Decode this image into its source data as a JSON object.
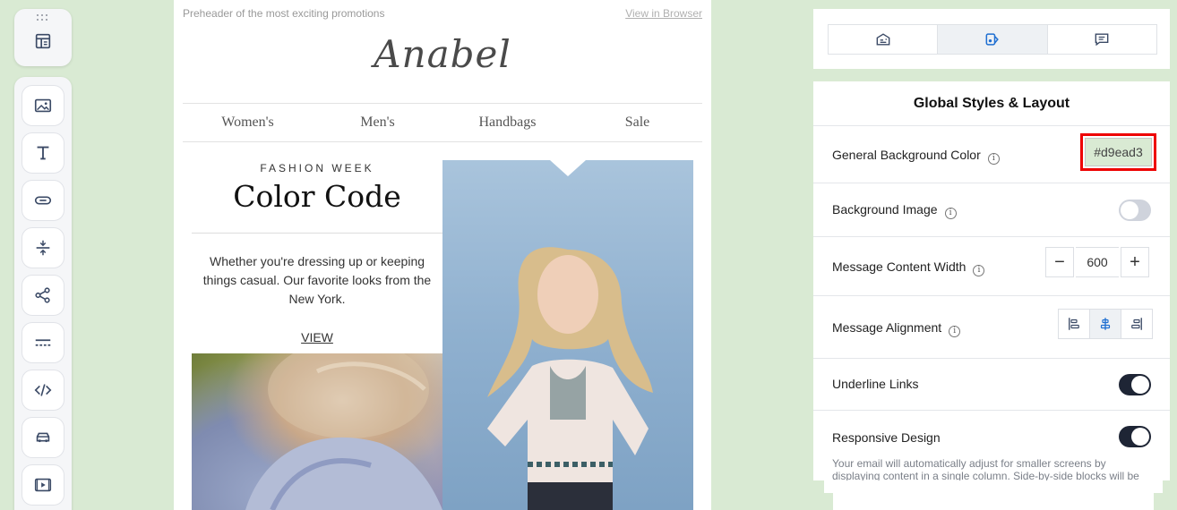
{
  "toolbar": {
    "top_button": {
      "icon": "layout-icon"
    },
    "blocks": [
      {
        "name": "image",
        "icon": "image-icon"
      },
      {
        "name": "text",
        "icon": "text-icon"
      },
      {
        "name": "button",
        "icon": "button-icon"
      },
      {
        "name": "spacer",
        "icon": "spacer-icon"
      },
      {
        "name": "social",
        "icon": "share-icon"
      },
      {
        "name": "divider",
        "icon": "divider-icon"
      },
      {
        "name": "html",
        "icon": "code-icon"
      },
      {
        "name": "product",
        "icon": "product-icon"
      },
      {
        "name": "video",
        "icon": "video-icon"
      }
    ]
  },
  "email": {
    "preheader": "Preheader of the most exciting promotions",
    "view_in_browser": "View in Browser",
    "logo": "Anabel",
    "nav": [
      "Women's",
      "Men's",
      "Handbags",
      "Sale"
    ],
    "kicker": "FASHION WEEK",
    "headline": "Color Code",
    "description": "Whether you're dressing up or keeping things casual. Our favorite looks from the New York.",
    "cta": "VIEW"
  },
  "panel": {
    "tabs": [
      {
        "name": "content",
        "icon": "content-icon",
        "active": false
      },
      {
        "name": "styles",
        "icon": "paint-bucket-icon",
        "active": true
      },
      {
        "name": "comments",
        "icon": "comment-icon",
        "active": false
      }
    ],
    "title": "Global Styles & Layout",
    "bg_color_label": "General Background Color",
    "bg_color_value": "#d9ead3",
    "bg_image_label": "Background Image",
    "bg_image_on": false,
    "content_width_label": "Message Content Width",
    "content_width_value": "600",
    "alignment_label": "Message Alignment",
    "alignment_selected": "center",
    "underline_label": "Underline Links",
    "underline_on": true,
    "responsive_label": "Responsive Design",
    "responsive_on": true,
    "responsive_help": "Your email will automatically adjust for smaller screens by displaying content in a single column. Side-by-side blocks will be"
  },
  "colors": {
    "canvas_bg": "#d9ead3",
    "toggle_on": "#1e2535",
    "highlight": "#ee0000"
  }
}
